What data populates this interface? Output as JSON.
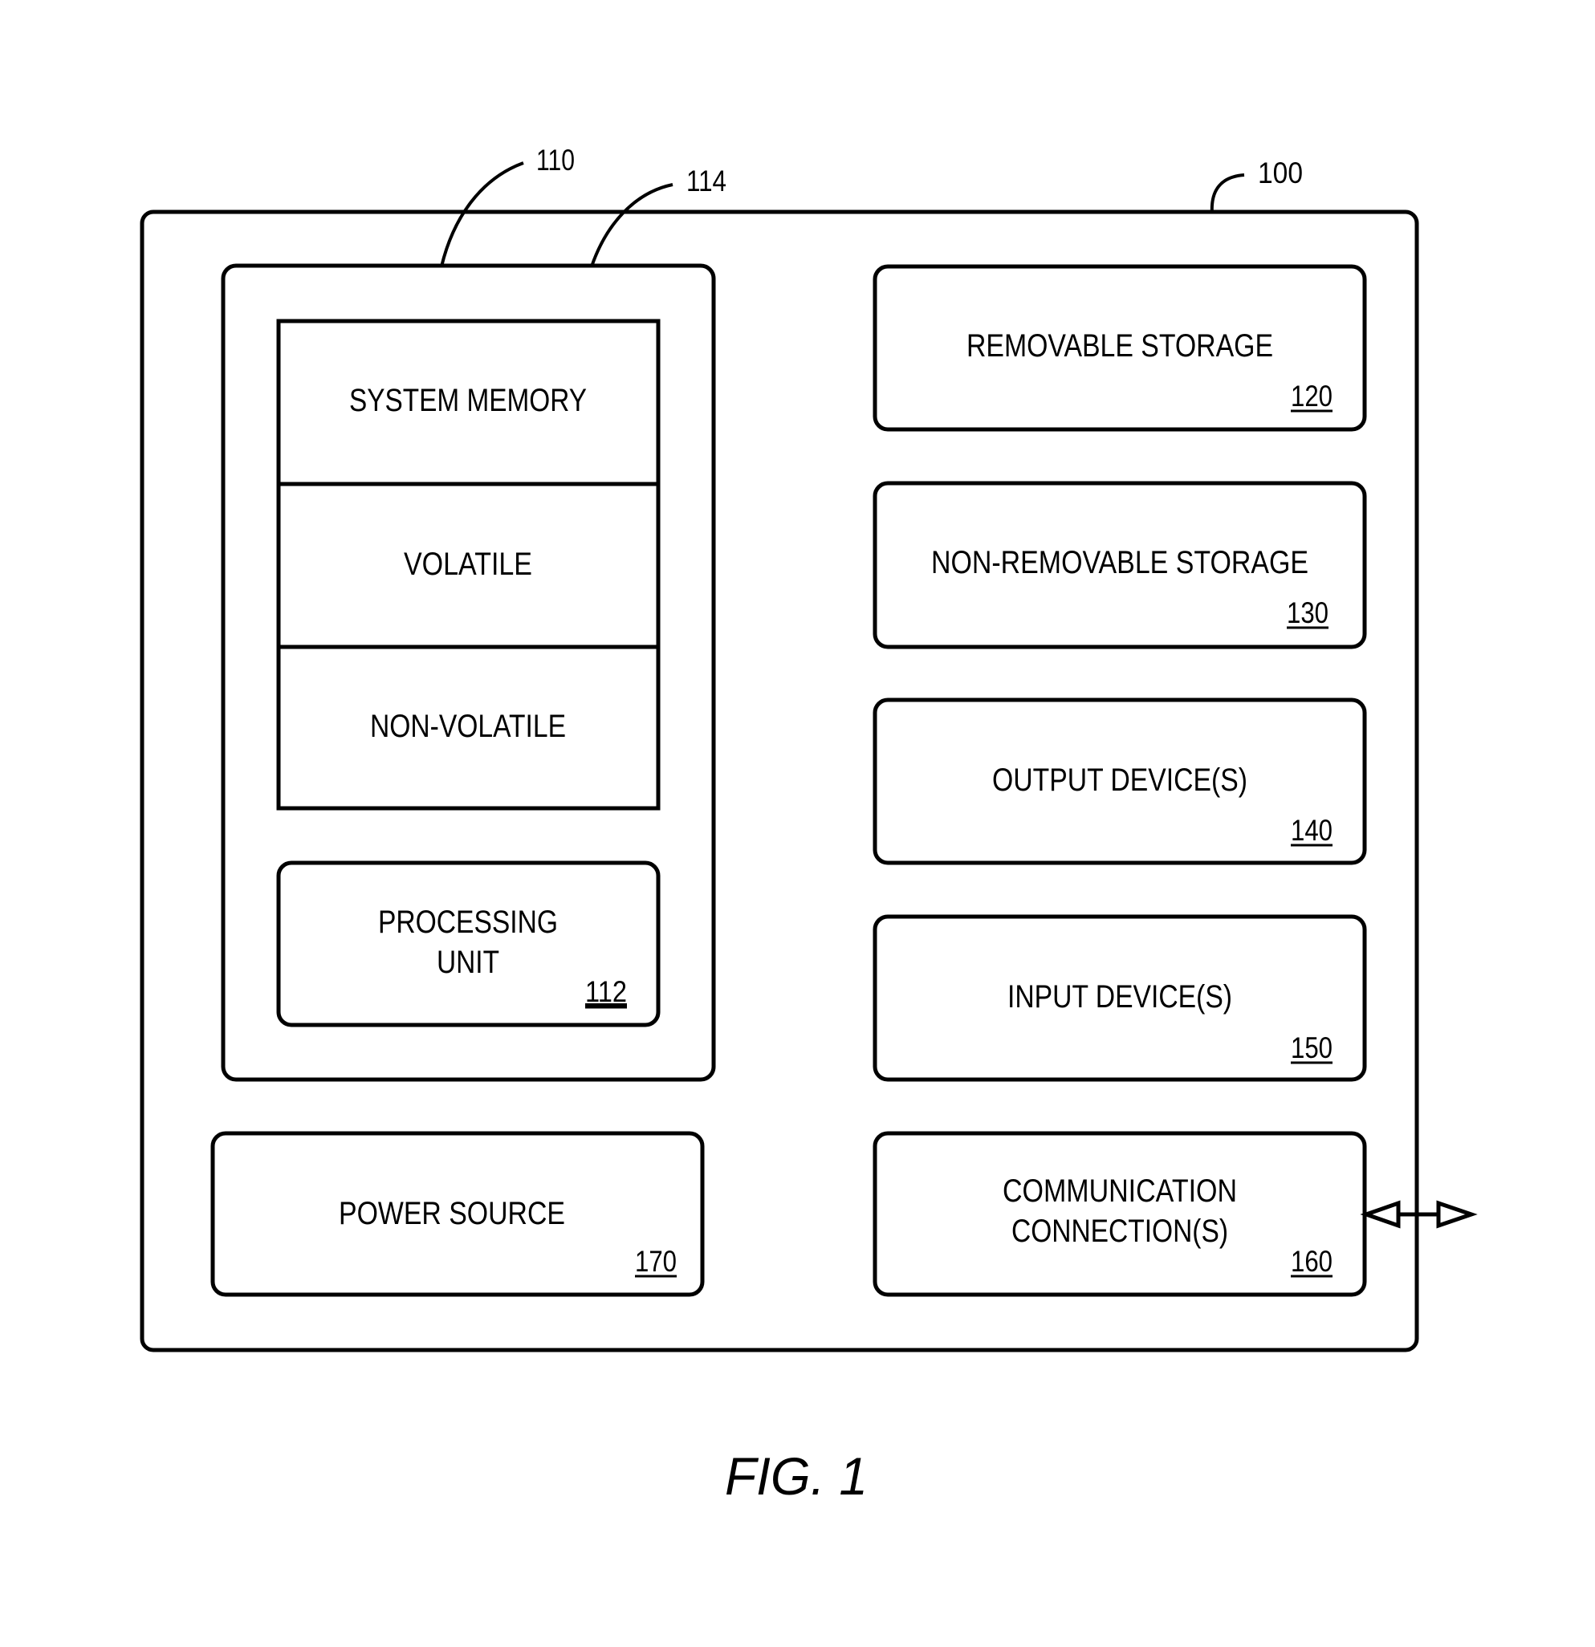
{
  "figure": {
    "caption": "FIG. 1",
    "device": {
      "ref": "100"
    },
    "memory_group": {
      "ref": "110",
      "memory_ref": "114"
    },
    "memory": {
      "title": "SYSTEM MEMORY",
      "sections": [
        "VOLATILE",
        "NON-VOLATILE"
      ]
    },
    "processing_unit": {
      "line1": "PROCESSING",
      "line2": "UNIT",
      "ref": "112"
    },
    "power_source": {
      "label": "POWER SOURCE",
      "ref": "170"
    },
    "components": [
      {
        "label": "REMOVABLE STORAGE",
        "ref": "120"
      },
      {
        "label": "NON-REMOVABLE STORAGE",
        "ref": "130"
      },
      {
        "label": "OUTPUT DEVICE(S)",
        "ref": "140"
      },
      {
        "label": "INPUT DEVICE(S)",
        "ref": "150"
      },
      {
        "line1": "COMMUNICATION",
        "line2": "CONNECTION(S)",
        "ref": "160"
      }
    ]
  }
}
